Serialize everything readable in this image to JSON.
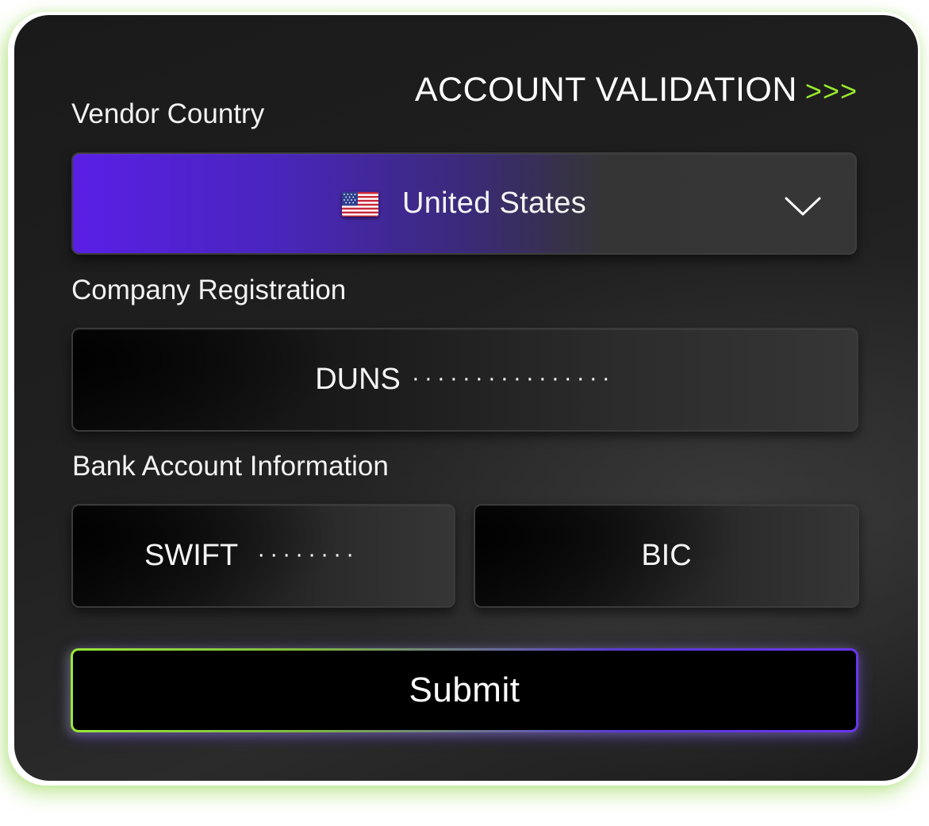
{
  "header": {
    "title": "ACCOUNT VALIDATION",
    "chevrons": ">>>",
    "accent_color": "#9aea2e"
  },
  "vendor_country": {
    "label": "Vendor Country",
    "selected_value": "United States",
    "flag_icon": "us-flag-icon",
    "dropdown_icon": "chevron-down-icon",
    "accent_color": "#5a1fe6"
  },
  "company_registration": {
    "label": "Company Registration",
    "duns_label": "DUNS",
    "duns_mask": "················"
  },
  "bank_account": {
    "label": "Bank Account Information",
    "swift_label": "SWIFT",
    "swift_mask": "········",
    "bic_label": "BIC"
  },
  "submit": {
    "label": "Submit"
  }
}
